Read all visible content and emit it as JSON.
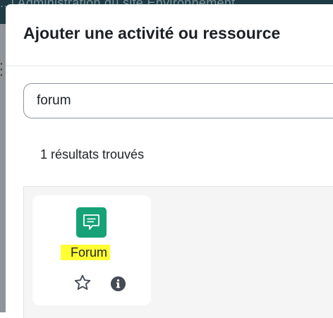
{
  "background_page": {
    "header_text": "...l  Administration du site  Environnement"
  },
  "modal": {
    "title": "Ajouter une activité ou ressource"
  },
  "search": {
    "value": "forum"
  },
  "results": {
    "count_text": "1 résultats trouvés",
    "items": [
      {
        "name": "Forum",
        "icon": "forum-speech-bubble-icon",
        "icon_color": "#15a276",
        "highlight_color": "#ffff33",
        "actions": [
          "star-icon",
          "info-icon"
        ]
      }
    ]
  }
}
